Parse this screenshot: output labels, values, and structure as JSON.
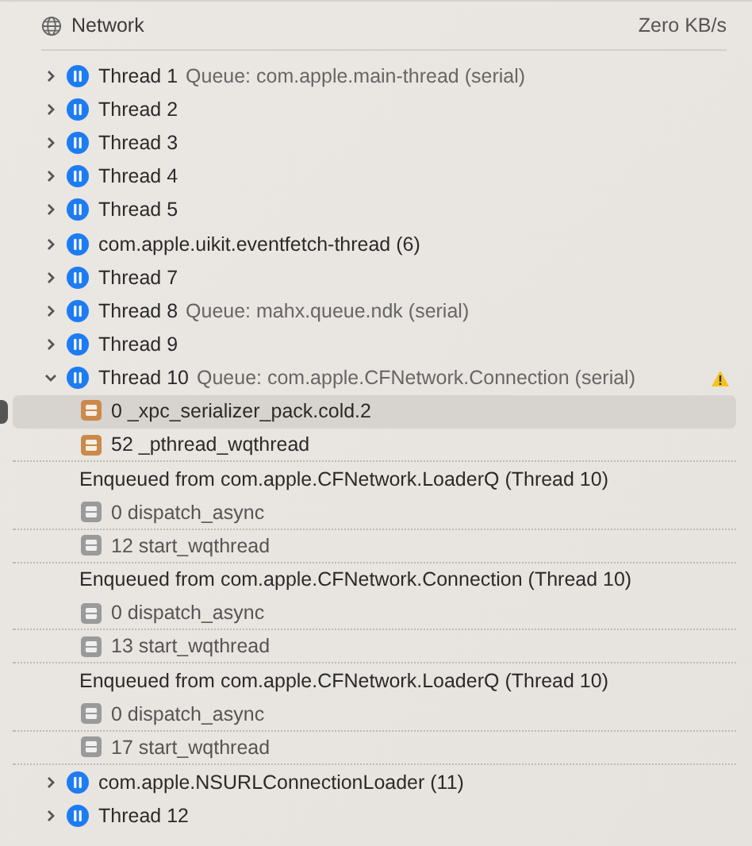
{
  "header": {
    "title": "Network",
    "rate": "Zero KB/s"
  },
  "threads": [
    {
      "name": "Thread 1",
      "queue": "Queue: com.apple.main-thread (serial)",
      "expanded": false,
      "warning": false
    },
    {
      "name": "Thread 2",
      "expanded": false,
      "warning": false
    },
    {
      "name": "Thread 3",
      "expanded": false,
      "warning": false
    },
    {
      "name": "Thread 4",
      "expanded": false,
      "warning": false
    },
    {
      "name": "Thread 5",
      "expanded": false,
      "warning": false
    },
    {
      "name": "com.apple.uikit.eventfetch-thread (6)",
      "expanded": false,
      "warning": false
    },
    {
      "name": "Thread 7",
      "expanded": false,
      "warning": false
    },
    {
      "name": "Thread 8",
      "queue": "Queue: mahx.queue.ndk (serial)",
      "expanded": false,
      "warning": false
    },
    {
      "name": "Thread 9",
      "expanded": false,
      "warning": false
    },
    {
      "name": "Thread 10",
      "queue": "Queue: com.apple.CFNetwork.Connection (serial)",
      "expanded": true,
      "warning": true,
      "children": [
        {
          "kind": "user",
          "label": "0 _xpc_serializer_pack.cold.2",
          "selected": true
        },
        {
          "kind": "user",
          "label": "52 _pthread_wqthread",
          "selected": false
        },
        {
          "kind": "enqueued",
          "label": "Enqueued from com.apple.CFNetwork.LoaderQ (Thread 10)"
        },
        {
          "kind": "system",
          "label": "0 dispatch_async",
          "selected": false
        },
        {
          "kind": "system",
          "label": "12 start_wqthread",
          "selected": false
        },
        {
          "kind": "enqueued",
          "label": "Enqueued from com.apple.CFNetwork.Connection (Thread 10)"
        },
        {
          "kind": "system",
          "label": "0 dispatch_async",
          "selected": false
        },
        {
          "kind": "system",
          "label": "13 start_wqthread",
          "selected": false
        },
        {
          "kind": "enqueued",
          "label": "Enqueued from com.apple.CFNetwork.LoaderQ (Thread 10)"
        },
        {
          "kind": "system",
          "label": "0 dispatch_async",
          "selected": false
        },
        {
          "kind": "system",
          "label": "17 start_wqthread",
          "selected": false
        }
      ]
    },
    {
      "name": "com.apple.NSURLConnectionLoader (11)",
      "expanded": false,
      "warning": false
    },
    {
      "name": "Thread 12",
      "expanded": false,
      "warning": false
    }
  ]
}
